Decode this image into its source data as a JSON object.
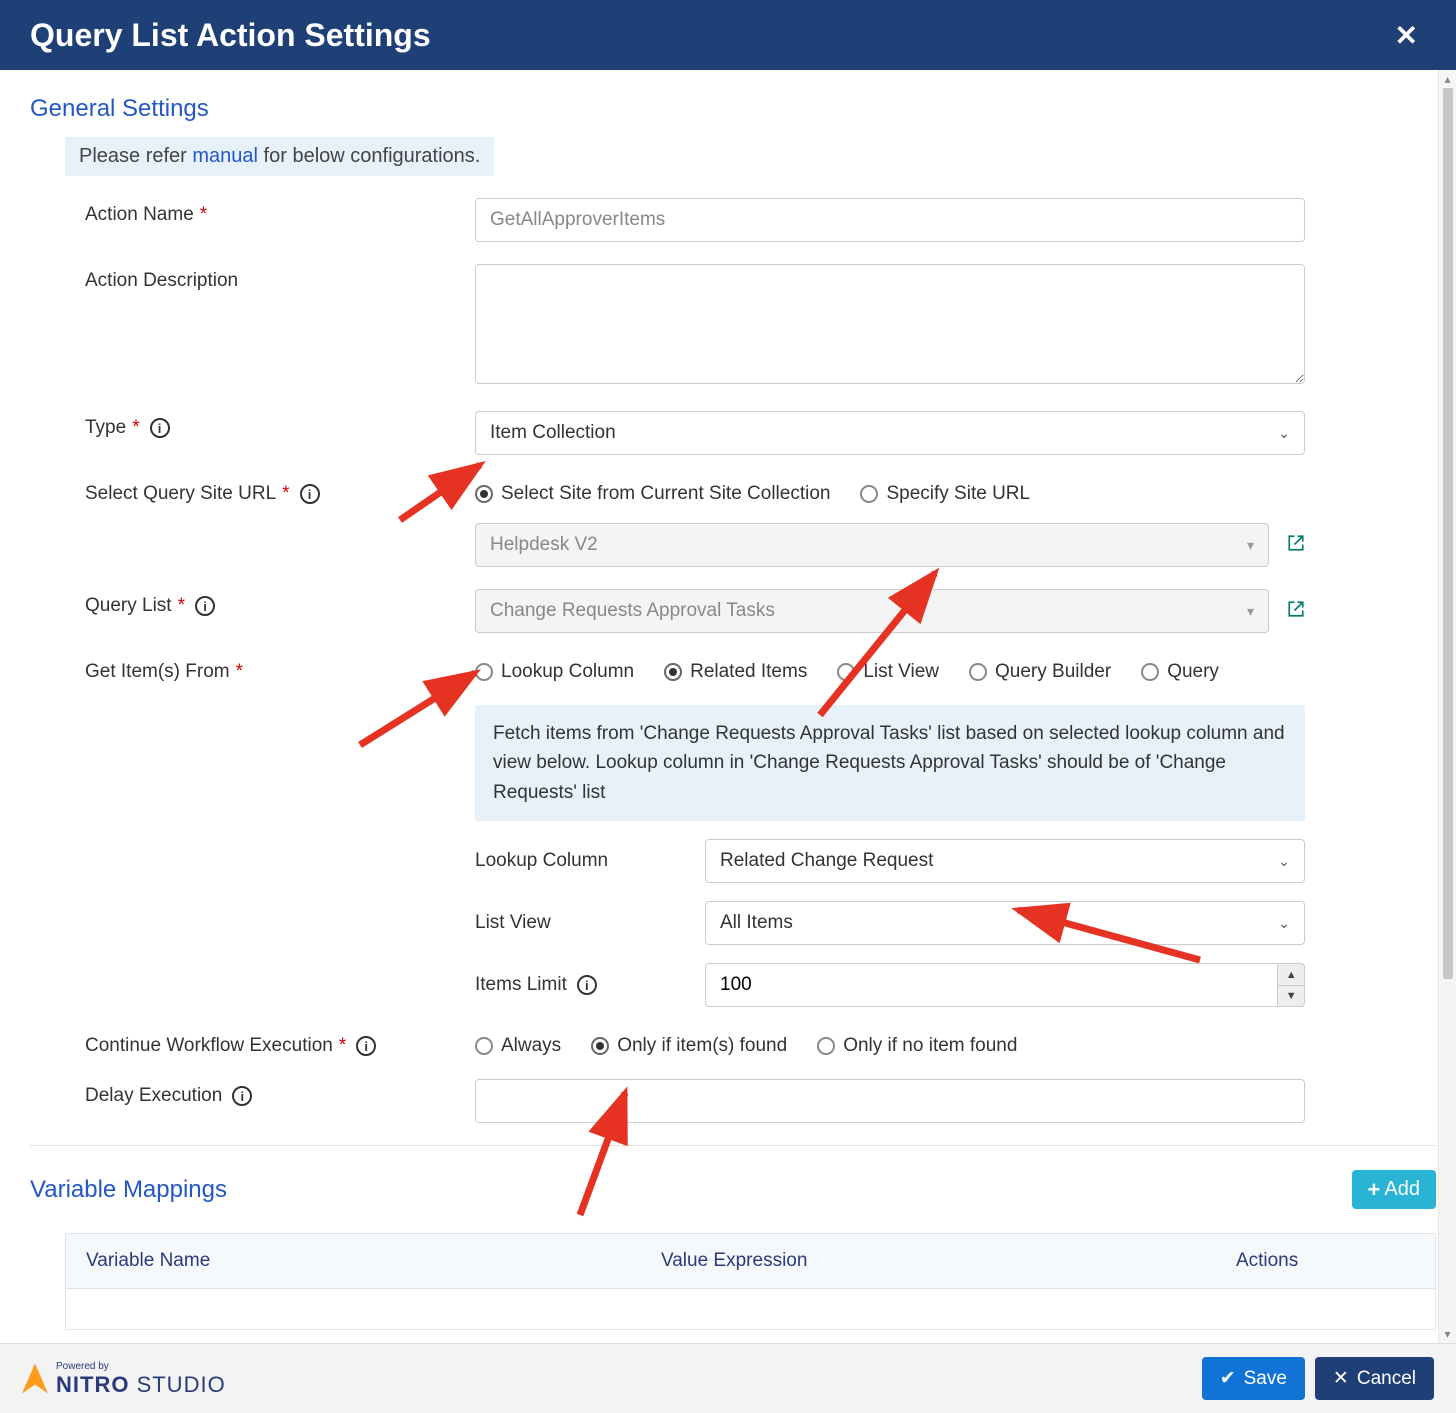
{
  "modal": {
    "title": "Query List Action Settings"
  },
  "general": {
    "section_title": "General Settings",
    "banner_prefix": "Please refer ",
    "banner_link": "manual",
    "banner_suffix": " for below configurations.",
    "labels": {
      "action_name": "Action Name",
      "action_description": "Action Description",
      "type": "Type",
      "select_query_site_url": "Select Query Site URL",
      "query_list": "Query List",
      "get_items_from": "Get Item(s) From",
      "continue_workflow": "Continue Workflow Execution",
      "delay_execution": "Delay Execution"
    },
    "action_name_placeholder": "GetAllApproverItems",
    "type_value": "Item Collection",
    "site_url_options": {
      "opt1": "Select Site from Current Site Collection",
      "opt2": "Specify Site URL"
    },
    "site_dropdown_value": "Helpdesk V2",
    "query_list_value": "Change Requests Approval Tasks",
    "get_items_options": {
      "lookup": "Lookup Column",
      "related": "Related Items",
      "list_view": "List View",
      "query_builder": "Query Builder",
      "query": "Query"
    },
    "info_box": "Fetch items from 'Change Requests Approval Tasks' list based on selected lookup column and view below. Lookup column in 'Change Requests Approval Tasks' should be of 'Change Requests' list",
    "sub_labels": {
      "lookup_column": "Lookup Column",
      "list_view": "List View",
      "items_limit": "Items Limit"
    },
    "lookup_column_value": "Related Change Request",
    "list_view_value": "All Items",
    "items_limit_value": "100",
    "continue_options": {
      "always": "Always",
      "only_if_found": "Only if item(s) found",
      "only_if_none": "Only if no item found"
    }
  },
  "varmap": {
    "section_title": "Variable Mappings",
    "add_label": "Add",
    "columns": {
      "name": "Variable Name",
      "expr": "Value Expression",
      "actions": "Actions"
    }
  },
  "footer": {
    "powered": "Powered by",
    "brand_bold": "NITRO",
    "brand_light": " STUDIO",
    "save": "Save",
    "cancel": "Cancel"
  }
}
